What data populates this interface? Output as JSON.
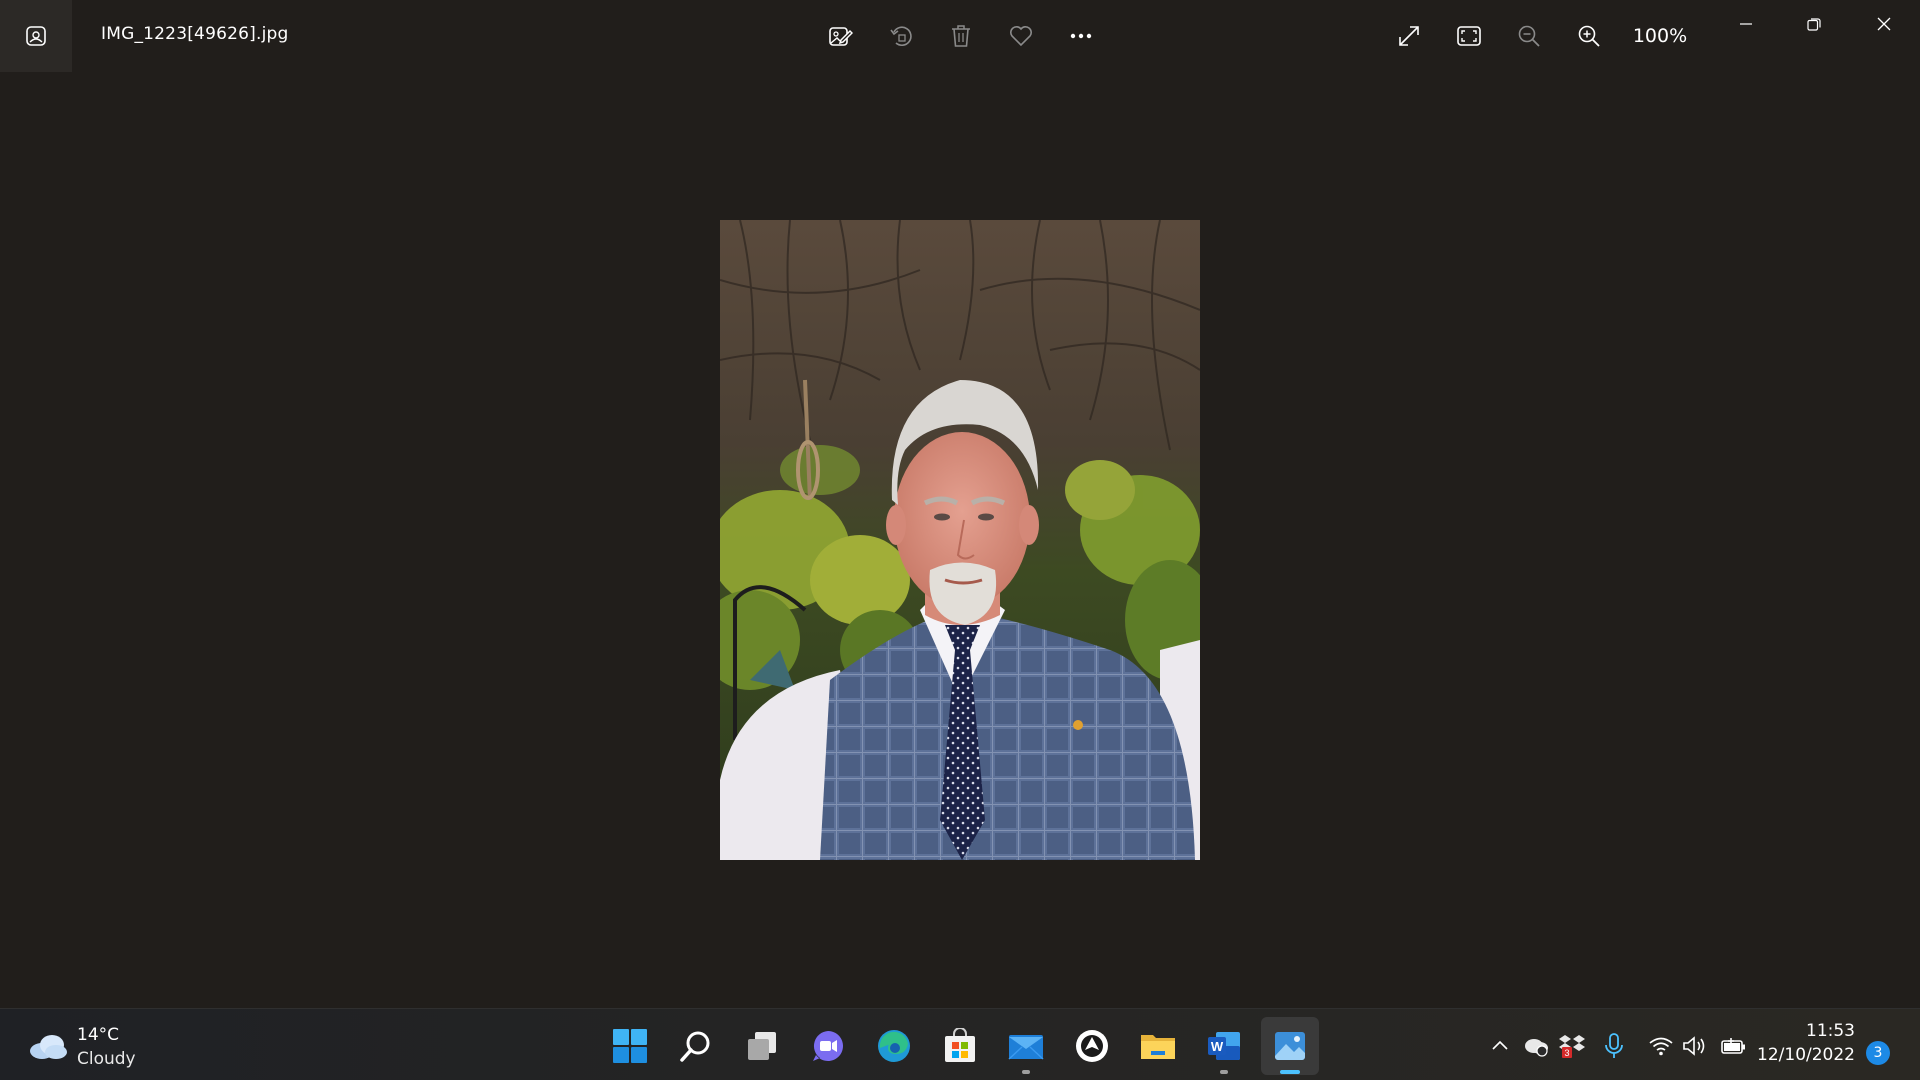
{
  "window": {
    "file_name": "IMG_1223[49626].jpg",
    "zoom_level": "100%"
  },
  "toolbar": {
    "icons": [
      "edit-image-icon",
      "rotate-icon",
      "delete-icon",
      "favorite-icon",
      "more-icon"
    ],
    "view_icons": [
      "fullscreen-icon",
      "fit-to-window-icon",
      "zoom-out-icon",
      "zoom-in-icon"
    ],
    "window_controls": [
      "minimize-icon",
      "restore-icon",
      "close-icon"
    ]
  },
  "taskbar": {
    "weather": {
      "temperature": "14°C",
      "condition": "Cloudy",
      "icon": "cloud-icon"
    },
    "apps": [
      {
        "name": "start-icon"
      },
      {
        "name": "search-icon"
      },
      {
        "name": "task-view-icon"
      },
      {
        "name": "chat-icon"
      },
      {
        "name": "edge-icon"
      },
      {
        "name": "store-icon"
      },
      {
        "name": "mail-icon"
      },
      {
        "name": "app-icon"
      },
      {
        "name": "file-explorer-icon"
      },
      {
        "name": "word-icon"
      },
      {
        "name": "photos-icon"
      }
    ],
    "tray": {
      "icons": [
        "chevron-up-icon",
        "onedrive-icon",
        "dropbox-icon",
        "microphone-icon",
        "wifi-icon",
        "volume-icon",
        "battery-icon"
      ],
      "dropbox_badge": "3",
      "time": "11:53",
      "date": "12/10/2022",
      "notification_count": "3"
    },
    "accent_color": "#4cc2ff"
  }
}
